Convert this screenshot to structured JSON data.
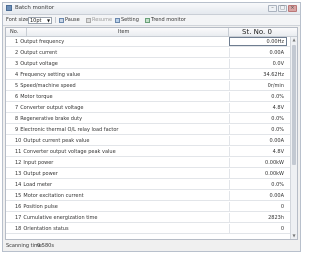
{
  "window": {
    "title": "Batch monitor",
    "buttons": {
      "minimize": "–",
      "maximize": "□",
      "close": "×"
    }
  },
  "toolbar": {
    "font_size_label": "Font size",
    "font_size_value": "10pt",
    "pause_label": "Pause",
    "resume_label": "Resume",
    "setting_label": "Setting",
    "trend_monitor_label": "Trend monitor"
  },
  "table": {
    "headers": {
      "no": "No.",
      "item": "Item",
      "station": "St. No. 0"
    },
    "selected_row": 1,
    "rows": [
      {
        "no": "1",
        "item": "Output frequency",
        "value": "0.00Hz"
      },
      {
        "no": "2",
        "item": "Output current",
        "value": "0.00A"
      },
      {
        "no": "3",
        "item": "Output voltage",
        "value": "0.0V"
      },
      {
        "no": "4",
        "item": "Frequency setting value",
        "value": "34.62Hz"
      },
      {
        "no": "5",
        "item": "Speed/machine speed",
        "value": "0r/min"
      },
      {
        "no": "6",
        "item": "Motor torque",
        "value": "0.0%"
      },
      {
        "no": "7",
        "item": "Converter output voltage",
        "value": "4.8V"
      },
      {
        "no": "8",
        "item": "Regenerative brake duty",
        "value": "0.0%"
      },
      {
        "no": "9",
        "item": "Electronic thermal O/L relay load factor",
        "value": "0.0%"
      },
      {
        "no": "10",
        "item": "Output current peak value",
        "value": "0.00A"
      },
      {
        "no": "11",
        "item": "Converter output voltage peak value",
        "value": "4.8V"
      },
      {
        "no": "12",
        "item": "Input power",
        "value": "0.00kW"
      },
      {
        "no": "13",
        "item": "Output power",
        "value": "0.00kW"
      },
      {
        "no": "14",
        "item": "Load meter",
        "value": "0.0%"
      },
      {
        "no": "15",
        "item": "Motor excitation current",
        "value": "0.00A"
      },
      {
        "no": "16",
        "item": "Position pulse",
        "value": "0"
      },
      {
        "no": "17",
        "item": "Cumulative energization time",
        "value": "2823h"
      },
      {
        "no": "18",
        "item": "Orientation status",
        "value": "0"
      }
    ]
  },
  "status": {
    "label": "Scanning time:",
    "value": "0.580s"
  }
}
